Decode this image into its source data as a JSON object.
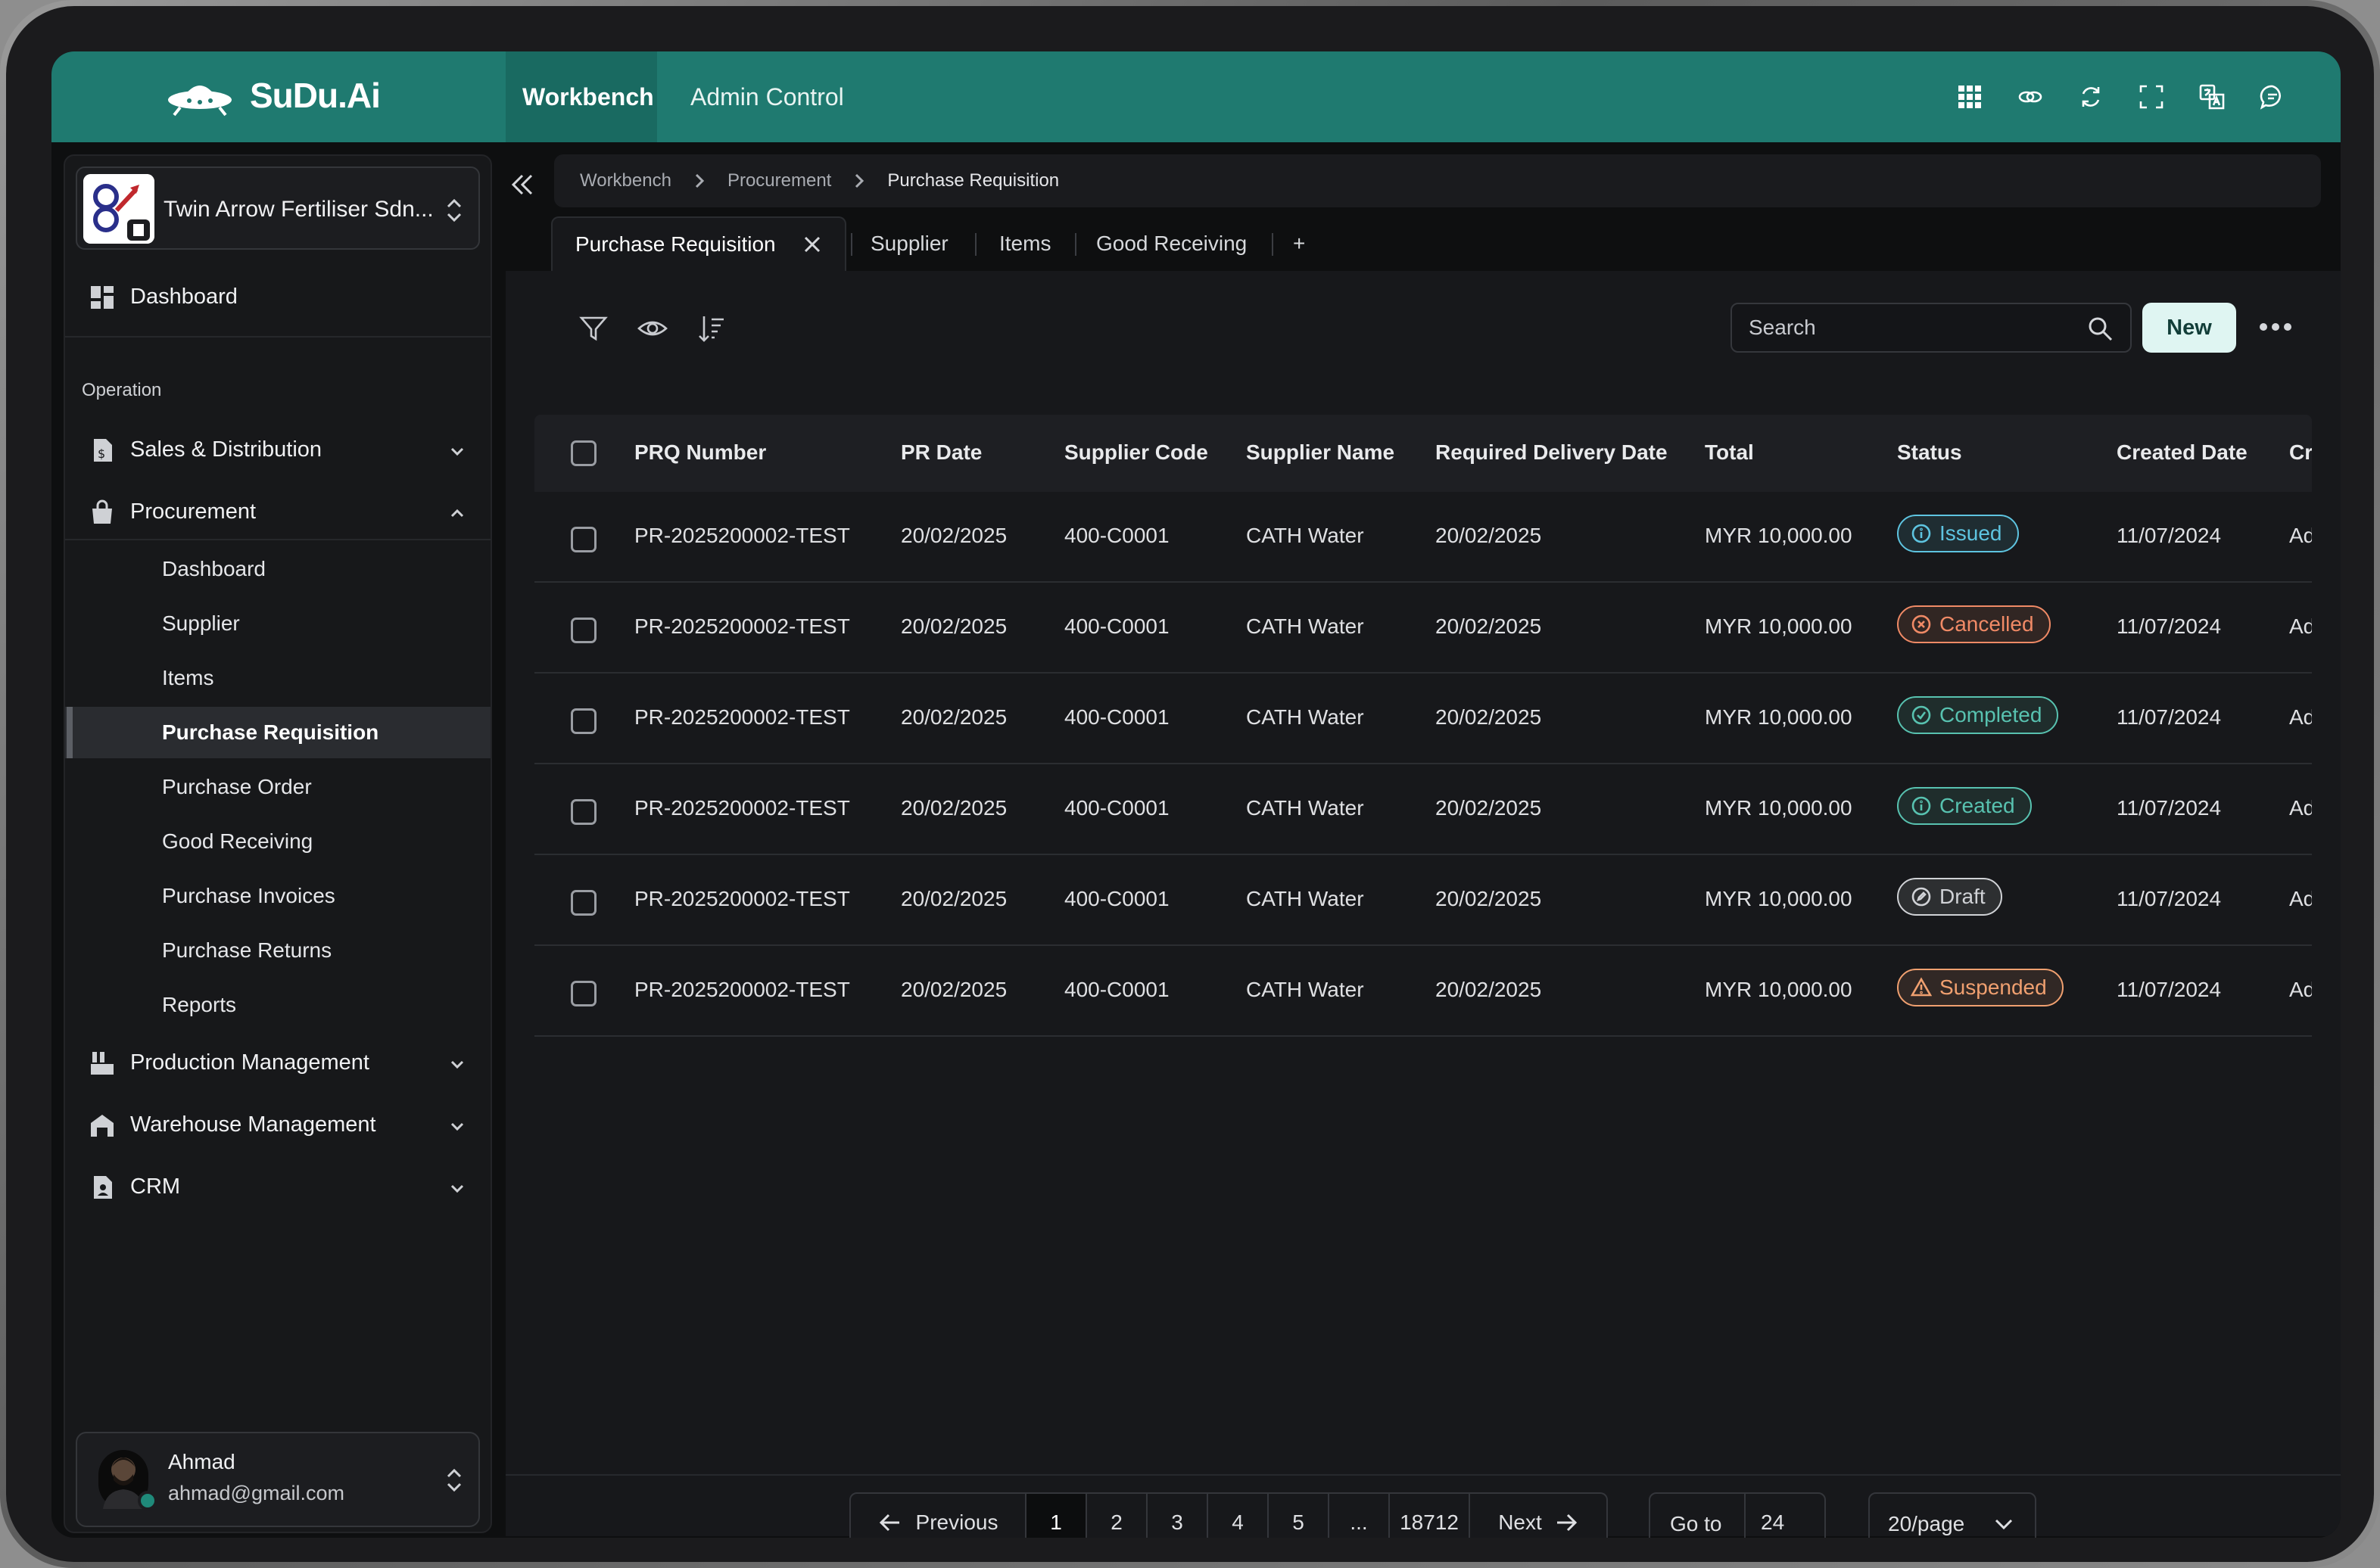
{
  "app": {
    "brand": "SuDu.Ai"
  },
  "topnav": {
    "tabs": [
      {
        "label": "Workbench"
      },
      {
        "label": "Admin Control"
      }
    ]
  },
  "topbar_icons": [
    "apps-grid-icon",
    "link-icon",
    "refresh-icon",
    "fullscreen-icon",
    "translate-icon",
    "chat-icon"
  ],
  "company": {
    "name": "Twin Arrow Fertiliser Sdn..."
  },
  "sidebar": {
    "dashboard": "Dashboard",
    "section": "Operation",
    "sales": "Sales & Distribution",
    "procurement": "Procurement",
    "procurement_items": [
      "Dashboard",
      "Supplier",
      "Items",
      "Purchase Requisition",
      "Purchase Order",
      "Good Receiving",
      "Purchase Invoices",
      "Purchase Returns",
      "Reports"
    ],
    "production": "Production Management",
    "warehouse": "Warehouse Management",
    "crm": "CRM"
  },
  "user": {
    "name": "Ahmad",
    "email": "ahmad@gmail.com"
  },
  "breadcrumb": [
    "Workbench",
    "Procurement",
    "Purchase Requisition"
  ],
  "page_tabs": [
    "Purchase Requisition",
    "Supplier",
    "Items",
    "Good Receiving",
    "+"
  ],
  "search": {
    "placeholder": "Search"
  },
  "actions": {
    "new": "New"
  },
  "table": {
    "columns": [
      "PRQ Number",
      "PR Date",
      "Supplier Code",
      "Supplier Name",
      "Required Delivery Date",
      "Total",
      "Status",
      "Created Date",
      "Cr"
    ],
    "rows": [
      {
        "prq": "PR-2025200002-TEST",
        "pr_date": "20/02/2025",
        "code": "400-C0001",
        "name": "CATH Water",
        "delivery": "20/02/2025",
        "total": "MYR 10,000.00",
        "status": "Issued",
        "created": "11/07/2024",
        "extra": "Ad"
      },
      {
        "prq": "PR-2025200002-TEST",
        "pr_date": "20/02/2025",
        "code": "400-C0001",
        "name": "CATH Water",
        "delivery": "20/02/2025",
        "total": "MYR 10,000.00",
        "status": "Cancelled",
        "created": "11/07/2024",
        "extra": "Ad"
      },
      {
        "prq": "PR-2025200002-TEST",
        "pr_date": "20/02/2025",
        "code": "400-C0001",
        "name": "CATH Water",
        "delivery": "20/02/2025",
        "total": "MYR 10,000.00",
        "status": "Completed",
        "created": "11/07/2024",
        "extra": "Ad"
      },
      {
        "prq": "PR-2025200002-TEST",
        "pr_date": "20/02/2025",
        "code": "400-C0001",
        "name": "CATH Water",
        "delivery": "20/02/2025",
        "total": "MYR 10,000.00",
        "status": "Created",
        "created": "11/07/2024",
        "extra": "Ad"
      },
      {
        "prq": "PR-2025200002-TEST",
        "pr_date": "20/02/2025",
        "code": "400-C0001",
        "name": "CATH Water",
        "delivery": "20/02/2025",
        "total": "MYR 10,000.00",
        "status": "Draft",
        "created": "11/07/2024",
        "extra": "Ad"
      },
      {
        "prq": "PR-2025200002-TEST",
        "pr_date": "20/02/2025",
        "code": "400-C0001",
        "name": "CATH Water",
        "delivery": "20/02/2025",
        "total": "MYR 10,000.00",
        "status": "Suspended",
        "created": "11/07/2024",
        "extra": "Ad"
      }
    ]
  },
  "status_colors": {
    "Issued": "#5ec4e0",
    "Cancelled": "#f08a66",
    "Completed": "#58c2b0",
    "Created": "#58c2b0",
    "Draft": "#d0d2d6",
    "Suspended": "#f0a070"
  },
  "pagination": {
    "previous": "Previous",
    "pages": [
      "1",
      "2",
      "3",
      "4",
      "5",
      "...",
      "18712"
    ],
    "current": "1",
    "next": "Next",
    "goto_label": "Go to",
    "goto_value": "24",
    "page_size": "20/page"
  }
}
